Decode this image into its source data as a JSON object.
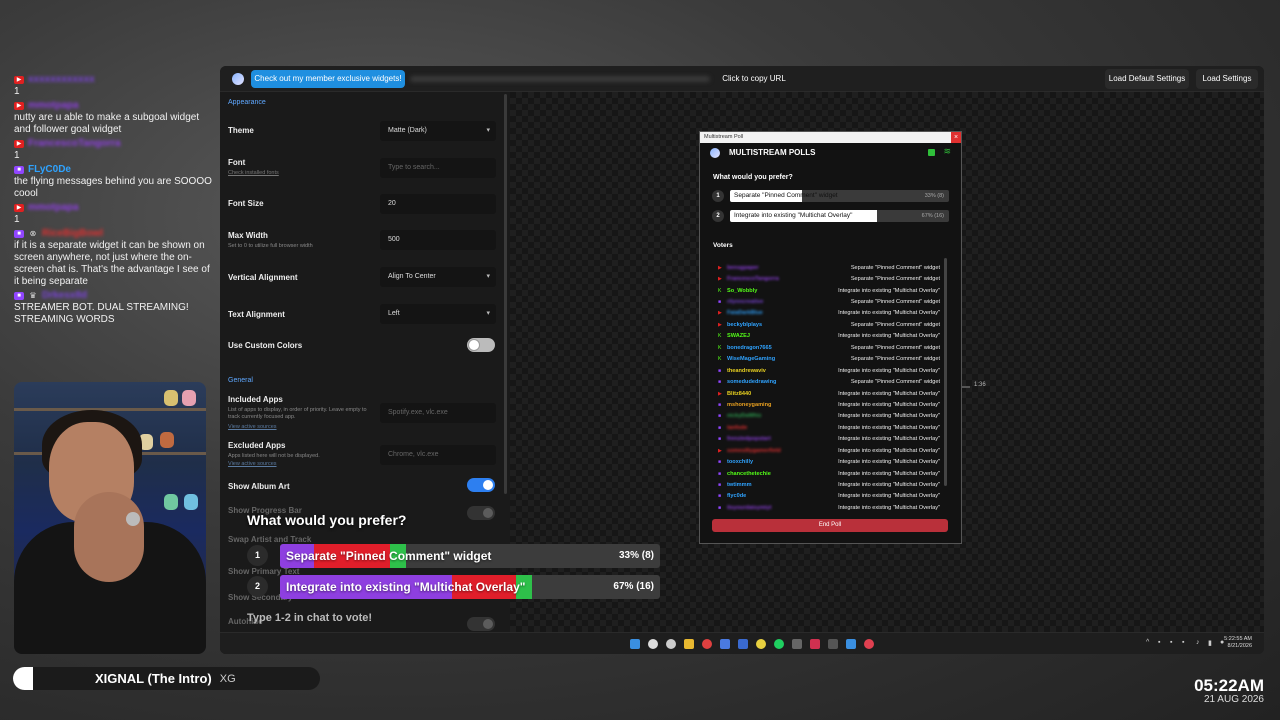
{
  "chat": [
    {
      "platform": "yt",
      "user": "xxxxxxxxxxxx",
      "blur": true,
      "color": "#7a44d8",
      "text": "1"
    },
    {
      "platform": "yt",
      "user": "mmotpapa",
      "blur": true,
      "color": "#8e3fe0",
      "text": "nutty are u able to make a subgoal widget and follower goal widget"
    },
    {
      "platform": "yt",
      "user": "FrancescoTangorra",
      "blur": true,
      "color": "#8e3fe0",
      "text": "1"
    },
    {
      "platform": "tw",
      "user": "FLyC0De",
      "blur": false,
      "color": "#2fa3ff",
      "text": "the flying messages behind you are SOOOO coool"
    },
    {
      "platform": "yt",
      "user": "mmotpapa",
      "blur": true,
      "color": "#8e3fe0",
      "text": "1"
    },
    {
      "platform": "tw",
      "user": "RiceBigBowl",
      "blur": true,
      "color": "#e03030",
      "text": "if it is a separate widget it can be shown on screen anywhere, not just where the on-screen chat is. That's the advantage I see of it being separate",
      "extra_badge": "⊗"
    },
    {
      "platform": "tw",
      "user": "Drkesx8d",
      "blur": true,
      "color": "#7a44d8",
      "text": "STREAMER BOT. DUAL STREAMING! STREAMING WORDS",
      "extra_badge": "♛"
    }
  ],
  "now_playing": {
    "title": "XIGNAL (The Intro)",
    "artist": "XG"
  },
  "clock": {
    "time": "05:22AM",
    "date": "21 AUG 2026"
  },
  "topbar": {
    "promo": "Check out my member exclusive widgets!",
    "copy_url": "Click to copy URL",
    "load_default": "Load Default Settings",
    "load_settings": "Load Settings"
  },
  "settings": {
    "appearance": "Appearance",
    "theme_label": "Theme",
    "theme_value": "Matte (Dark)",
    "font_label": "Font",
    "font_link": "Check installed fonts",
    "font_placeholder": "Type to search...",
    "font_size_label": "Font Size",
    "font_size_value": "20",
    "max_width_label": "Max Width",
    "max_width_sub": "Set to 0 to utilize full browser width",
    "max_width_value": "500",
    "valign_label": "Vertical Alignment",
    "valign_value": "Align To Center",
    "talign_label": "Text Alignment",
    "talign_value": "Left",
    "custom_colors_label": "Use Custom Colors",
    "general": "General",
    "included_label": "Included Apps",
    "included_sub": "List of apps to display, in order of priority. Leave empty to track currently focused app.",
    "included_link": "View active sources",
    "included_placeholder": "Spotify.exe, vlc.exe",
    "excluded_label": "Excluded Apps",
    "excluded_sub": "Apps listed here will not be displayed.",
    "excluded_link": "View active sources",
    "excluded_placeholder": "Chrome, vlc.exe",
    "album_art_label": "Show Album Art",
    "hidden_1": "Show Progress Bar",
    "hidden_2": "Swap Artist and Track",
    "hidden_3": "Show Primary Text",
    "hidden_4": "Show Secondary",
    "hidden_5": "Autohide"
  },
  "preview": {
    "timer": "1:36"
  },
  "poll_window": {
    "titlebar": "Multistream Poll",
    "app_title": "MULTISTREAM POLLS",
    "question": "What would you prefer?",
    "options": [
      {
        "num": "1",
        "label": "Separate \"Pinned Comment\" widget",
        "pct": "33% (8)",
        "fraction": 0.33
      },
      {
        "num": "2",
        "label": "Integrate into existing \"Multichat Overlay\"",
        "pct": "67% (16)",
        "fraction": 0.67
      }
    ],
    "voters_title": "Voters",
    "end_poll": "End Poll"
  },
  "voters": [
    {
      "p": "yt",
      "name": "bensgpaper",
      "blur": true,
      "color": "#8e3fe0",
      "choice": "Separate \"Pinned Comment\" widget"
    },
    {
      "p": "yt",
      "name": "FrancescoTangorra",
      "blur": true,
      "color": "#8e3fe0",
      "choice": "Separate \"Pinned Comment\" widget"
    },
    {
      "p": "kick",
      "name": "So_Wobbly",
      "blur": false,
      "color": "#53fc18",
      "choice": "Integrate into existing \"Multichat Overlay\""
    },
    {
      "p": "tw",
      "name": "rilynncreative",
      "blur": true,
      "color": "#7a44d8",
      "choice": "Separate \"Pinned Comment\" widget"
    },
    {
      "p": "yt",
      "name": "FaiaDarkBlue",
      "blur": true,
      "color": "#2fa3ff",
      "choice": "Integrate into existing \"Multichat Overlay\""
    },
    {
      "p": "yt",
      "name": "beckyblplays",
      "blur": false,
      "color": "#2fa3ff",
      "choice": "Separate \"Pinned Comment\" widget"
    },
    {
      "p": "kick",
      "name": "SWAZEJ",
      "blur": false,
      "color": "#53fc18",
      "choice": "Integrate into existing \"Multichat Overlay\""
    },
    {
      "p": "kick",
      "name": "bonedragon7665",
      "blur": false,
      "color": "#2fa3ff",
      "choice": "Separate \"Pinned Comment\" widget"
    },
    {
      "p": "kick",
      "name": "WiseMageGaming",
      "blur": false,
      "color": "#2fa3ff",
      "choice": "Separate \"Pinned Comment\" widget"
    },
    {
      "p": "tw",
      "name": "theandrewaviv",
      "blur": false,
      "color": "#e8d020",
      "choice": "Integrate into existing \"Multichat Overlay\""
    },
    {
      "p": "tw",
      "name": "somedudedrawing",
      "blur": false,
      "color": "#2fa3ff",
      "choice": "Separate \"Pinned Comment\" widget"
    },
    {
      "p": "yt",
      "name": "Blitz8440",
      "blur": false,
      "color": "#e8d020",
      "choice": "Integrate into existing \"Multichat Overlay\""
    },
    {
      "p": "tw",
      "name": "mshoneygaming",
      "blur": false,
      "color": "#e8a020",
      "choice": "Integrate into existing \"Multichat Overlay\""
    },
    {
      "p": "tw",
      "name": "nickyDaWhiz",
      "blur": true,
      "color": "#2ea050",
      "choice": "Integrate into existing \"Multichat Overlay\""
    },
    {
      "p": "tw",
      "name": "tanfode",
      "blur": true,
      "color": "#e03030",
      "choice": "Integrate into existing \"Multichat Overlay\""
    },
    {
      "p": "tw",
      "name": "frenziedpopstart",
      "blur": true,
      "color": "#8e3fe0",
      "choice": "Integrate into existing \"Multichat Overlay\""
    },
    {
      "p": "yt",
      "name": "somesillygamerfield",
      "blur": true,
      "color": "#e03030",
      "choice": "Integrate into existing \"Multichat Overlay\""
    },
    {
      "p": "tw",
      "name": "tooxchilly",
      "blur": false,
      "color": "#2fa3ff",
      "choice": "Integrate into existing \"Multichat Overlay\""
    },
    {
      "p": "tw",
      "name": "chancethetechie",
      "blur": false,
      "color": "#53fc18",
      "choice": "Integrate into existing \"Multichat Overlay\""
    },
    {
      "p": "tw",
      "name": "twtimmm",
      "blur": false,
      "color": "#2fa3ff",
      "choice": "Integrate into existing \"Multichat Overlay\""
    },
    {
      "p": "tw",
      "name": "flyc0de",
      "blur": false,
      "color": "#2fa3ff",
      "choice": "Integrate into existing \"Multichat Overlay\""
    },
    {
      "p": "tw",
      "name": "itsyourdaisymiyt",
      "blur": true,
      "color": "#8e3fe0",
      "choice": "Integrate into existing \"Multichat Overlay\""
    }
  ],
  "overlay_poll": {
    "question": "What would you prefer?",
    "options": [
      {
        "num": "1",
        "label": "Separate \"Pinned Comment\" widget",
        "pct": "33% (8)"
      },
      {
        "num": "2",
        "label": "Integrate into existing \"Multichat Overlay\"",
        "pct": "67% (16)"
      }
    ],
    "footer": "Type 1-2 in chat to vote!"
  },
  "taskbar": {
    "time": "5:22:55 AM",
    "date": "8/21/2026"
  },
  "colors": {
    "accent": "#1f8fe0",
    "end_poll": "#b9303a",
    "youtube": "#e02020",
    "twitch": "#9146ff",
    "kick": "#53fc18"
  }
}
